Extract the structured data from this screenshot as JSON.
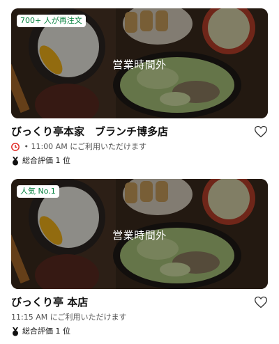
{
  "restaurants": [
    {
      "badge": "700+ 人が再注文",
      "status_overlay": "営業時間外",
      "name": "びっくり亭本家　ブランチ博多店",
      "schedule_prefix": " • ",
      "schedule": "11:00 AM にご利用いただけます",
      "show_clock_icon": true,
      "rating": "総合評価 1 位"
    },
    {
      "badge": "人気 No.1",
      "status_overlay": "営業時間外",
      "name": "びっくり亭 本店",
      "schedule_prefix": "",
      "schedule": "11:15 AM にご利用いただけます",
      "show_clock_icon": false,
      "rating": "総合評価 1 位"
    }
  ],
  "colors": {
    "badge_text": "#06823f",
    "clock_icon": "#e0201b",
    "overlay": "rgba(0,0,0,0.40)"
  },
  "icons": {
    "favorite": "heart-outline-icon",
    "closed_schedule": "clock-icon",
    "ranking": "medal-icon"
  }
}
